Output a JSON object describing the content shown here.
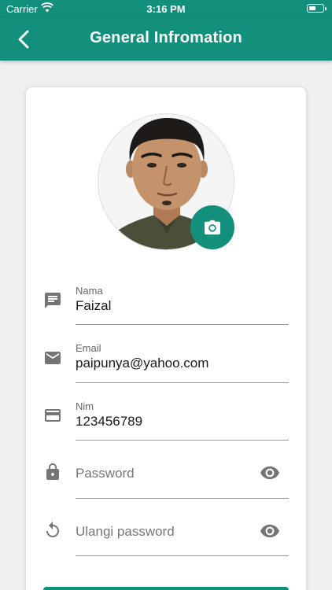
{
  "status_bar": {
    "carrier": "Carrier",
    "time": "3:16 PM"
  },
  "app_bar": {
    "title": "General Infromation",
    "back_icon": "chevron-left-icon"
  },
  "profile": {
    "avatar": "profile-photo",
    "camera_icon": "camera-icon"
  },
  "form": {
    "nama": {
      "label": "Nama",
      "value": "Faizal",
      "icon": "message-icon"
    },
    "email": {
      "label": "Email",
      "value": "paipunya@yahoo.com",
      "icon": "mail-icon"
    },
    "nim": {
      "label": "Nim",
      "value": "123456789",
      "icon": "card-icon"
    },
    "password": {
      "placeholder": "Password",
      "icon": "lock-icon",
      "toggle_icon": "eye-icon"
    },
    "ulangi_password": {
      "placeholder": "Ulangi password",
      "icon": "restore-icon",
      "toggle_icon": "eye-icon"
    }
  },
  "colors": {
    "primary": "#13907c",
    "background": "#eef0f2",
    "icon": "#757575"
  }
}
